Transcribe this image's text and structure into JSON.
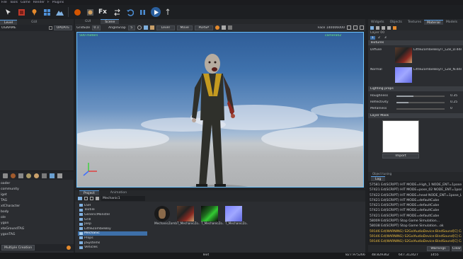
{
  "menu": {
    "items": [
      "File",
      "Tools",
      "Game",
      "Render",
      "F",
      "Plugins"
    ]
  },
  "toolbar": {
    "fx_label": "Fx"
  },
  "left_panel": {
    "tabs": [
      "Level",
      "GUI"
    ],
    "header_name": "OGNAME",
    "update_label": "UPDATE",
    "tree_items": [
      "oader",
      "community",
      "iget",
      "TAG",
      "xtCharacter",
      "body",
      "ole",
      "ygon",
      "xtoGroundTAG",
      "ygonTAG"
    ],
    "footer_label": "Multiple Creation"
  },
  "viewport": {
    "tabs": [
      "GUI",
      "Scene"
    ],
    "grid_label": "GridSize",
    "grid_value": "0.1",
    "angle_label": "AngleSnap",
    "angle_value": "5",
    "mode_value": "Level",
    "move_label": "Move",
    "persp_value": "PERSP",
    "face_count": "Face 140006000",
    "speed_label": "500 meters",
    "camera_label": "camera02"
  },
  "right_panel": {
    "tabs": [
      "Widgets",
      "Objects",
      "Textures",
      "Material",
      "Models"
    ],
    "layer_label": "Layer 00",
    "layer_num_tabs": [
      "1",
      "2",
      "3"
    ],
    "textures_header": "Textures",
    "diffuse_label": "Diffuse",
    "diffuse_file": "LittleZombieBoy/T_LZB_D.dds",
    "normal_label": "Normal",
    "normal_file": "LittleZombieBoy/T_LZB_N.dds",
    "lighting_header": "Lighting props",
    "props": [
      {
        "label": "Roughness",
        "value": "0.35",
        "fill": 0.35
      },
      {
        "label": "Reflectivity",
        "value": "0.25",
        "fill": 0.25
      },
      {
        "label": "Metalness",
        "value": "0",
        "fill": 0.0
      }
    ],
    "layer_mask_header": "Layer Mask",
    "import_label": "Import",
    "extra_tab_1": "Object tuning",
    "extra_tab_2": "Log"
  },
  "project": {
    "tabs": [
      "Project",
      "Animation"
    ],
    "path": "Mechanic1",
    "folders": [
      "ESH",
      "Textile",
      "GenericMonster",
      "Grill",
      "Jeep",
      "LittleZombieBoy",
      "Mechanic",
      "Props",
      "pSystems",
      "Vehicles"
    ],
    "assets": [
      "MechanicZomb...",
      "T_MechanicZo...",
      "T_MechanicZo...",
      "T_MechanicZo..."
    ]
  },
  "log": {
    "lines": [
      {
        "text": "57581 Ed(SCRIPT) HIT MODE=High_1 NODE_ENT=1pose_LittleZombieBoy",
        "warn": false
      },
      {
        "text": "57421 Ed(SCRIPT) HIT MODE=pose_02 NODE_ENT=1pose_LittleZombieBoy",
        "warn": false
      },
      {
        "text": "57422 Ed(SCRIPT) HIT MODE=head NODE_ENT=1pose_LittleZombieBoy",
        "warn": false
      },
      {
        "text": "57421 Ed(SCRIPT) HIT MODE=defaultCube",
        "warn": false
      },
      {
        "text": "57421 Ed(SCRIPT) HIT MODE=defaultCube",
        "warn": false
      },
      {
        "text": "57421 Ed(SCRIPT) HIT MODE=defaultCube",
        "warn": false
      },
      {
        "text": "57421 Ed(SCRIPT) HIT MODE=defaultCube",
        "warn": false
      },
      {
        "text": "58009 Ed(SCRIPT) Stop Game Simulation...",
        "warn": false
      },
      {
        "text": "58038 Ed(SCRIPT) Stop Game Simulation...ok",
        "warn": false
      },
      {
        "text": "59146 Ed(WARNING) S2GxlAudioDevice:BindSound[C] Cannot bind sound",
        "warn": true
      },
      {
        "text": "59146 Ed(WARNING) S2GxlAudioDevice:BindSound[C] Cannot bind sound",
        "warn": true
      },
      {
        "text": "59146 Ed(WARNING) S2GxlAudioDevice:BindSound[C] Cannot bind sound",
        "warn": true
      }
    ],
    "filter_value": "Warnings",
    "clear_label": "Clear"
  },
  "status": {
    "center_text": "Text",
    "coord_x": "827.975266",
    "coord_y": "48.829362",
    "coord_z": "647.312427",
    "fps": "1455"
  }
}
